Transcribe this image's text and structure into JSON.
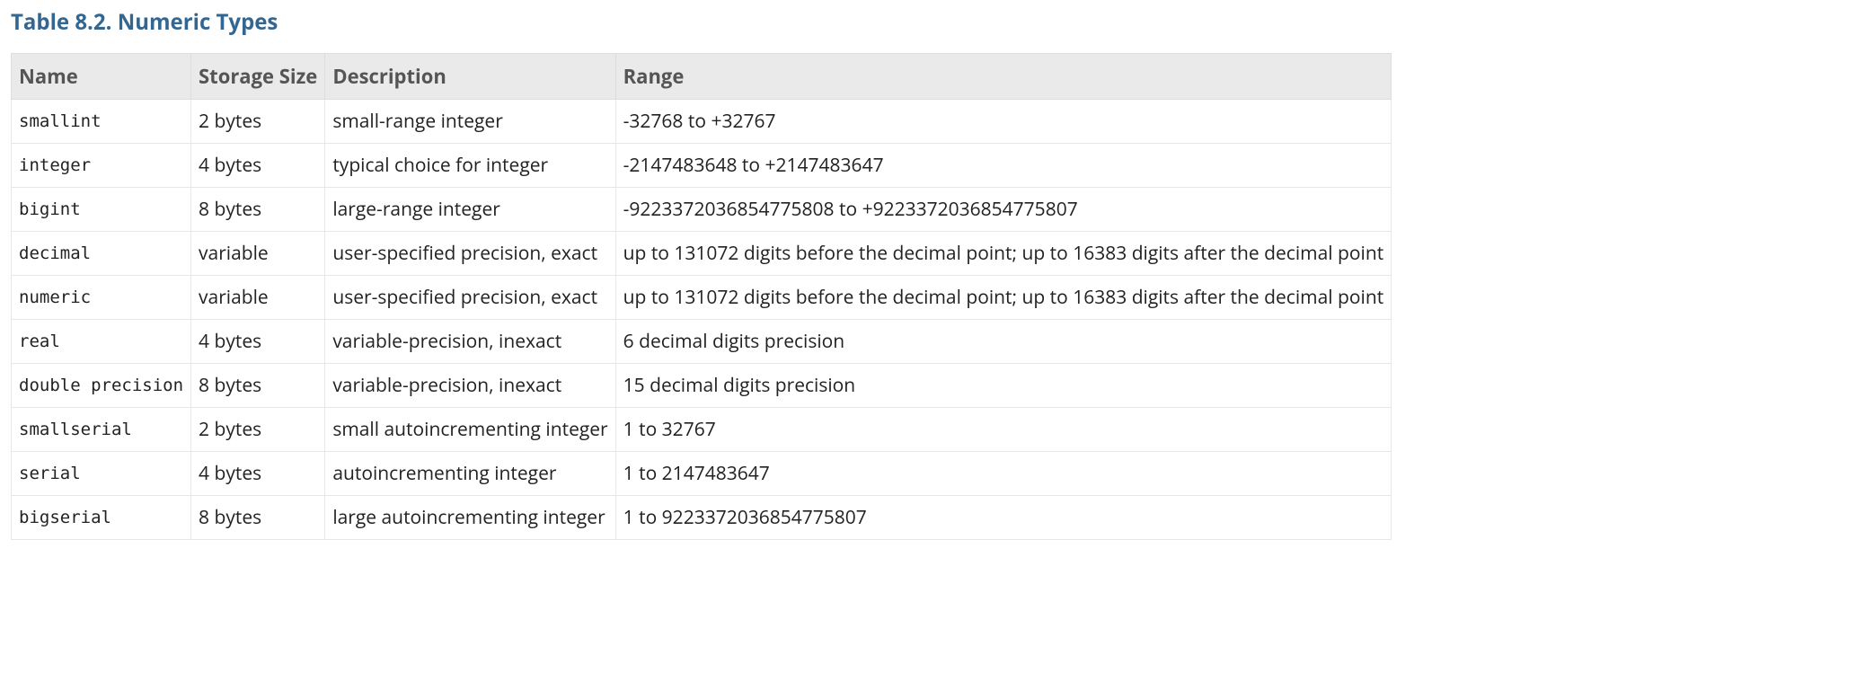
{
  "title": "Table 8.2. Numeric Types",
  "columns": [
    "Name",
    "Storage Size",
    "Description",
    "Range"
  ],
  "rows": [
    {
      "name": "smallint",
      "storage": "2 bytes",
      "description": "small-range integer",
      "range": "-32768 to +32767"
    },
    {
      "name": "integer",
      "storage": "4 bytes",
      "description": "typical choice for integer",
      "range": "-2147483648 to +2147483647"
    },
    {
      "name": "bigint",
      "storage": "8 bytes",
      "description": "large-range integer",
      "range": "-9223372036854775808 to +9223372036854775807"
    },
    {
      "name": "decimal",
      "storage": "variable",
      "description": "user-specified precision, exact",
      "range": "up to 131072 digits before the decimal point; up to 16383 digits after the decimal point"
    },
    {
      "name": "numeric",
      "storage": "variable",
      "description": "user-specified precision, exact",
      "range": "up to 131072 digits before the decimal point; up to 16383 digits after the decimal point"
    },
    {
      "name": "real",
      "storage": "4 bytes",
      "description": "variable-precision, inexact",
      "range": "6 decimal digits precision"
    },
    {
      "name": "double precision",
      "storage": "8 bytes",
      "description": "variable-precision, inexact",
      "range": "15 decimal digits precision"
    },
    {
      "name": "smallserial",
      "storage": "2 bytes",
      "description": "small autoincrementing integer",
      "range": "1 to 32767"
    },
    {
      "name": "serial",
      "storage": "4 bytes",
      "description": "autoincrementing integer",
      "range": "1 to 2147483647"
    },
    {
      "name": "bigserial",
      "storage": "8 bytes",
      "description": "large autoincrementing integer",
      "range": "1 to 9223372036854775807"
    }
  ]
}
